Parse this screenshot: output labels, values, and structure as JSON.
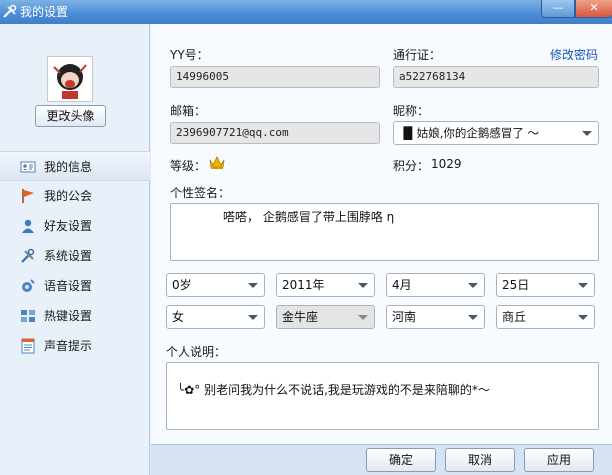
{
  "window": {
    "title": "我的设置",
    "minimize_label": "—",
    "close_label": "✕"
  },
  "sidebar": {
    "change_avatar": "更改头像",
    "items": [
      {
        "label": "我的信息",
        "icon": "id-card-icon"
      },
      {
        "label": "我的公会",
        "icon": "flag-icon"
      },
      {
        "label": "好友设置",
        "icon": "user-icon"
      },
      {
        "label": "系统设置",
        "icon": "tools-icon"
      },
      {
        "label": "语音设置",
        "icon": "speaker-icon"
      },
      {
        "label": "热键设置",
        "icon": "keyboard-icon"
      },
      {
        "label": "声音提示",
        "icon": "notice-icon"
      }
    ]
  },
  "form": {
    "yy_label": "YY号：",
    "yy_value": "14996005",
    "passport_label": "通行证：",
    "change_password": "修改密码",
    "passport_value": "a522768134",
    "email_label": "邮箱：",
    "email_value": "2396907721@qq.com",
    "nickname_label": "昵称：",
    "nickname_value": "▐▌姑娘,你的企鹅感冒了 ～",
    "level_label": "等级：",
    "points_label": "积分：",
    "points_value": "1029",
    "signature_label": "个性签名：",
    "signature_value": "嗒嗒，  企鹅感冒了带上围脖咯 η",
    "age": "0岁",
    "year": "2011年",
    "month": "4月",
    "day": "25日",
    "gender": "女",
    "zodiac": "金牛座",
    "province": "河南",
    "city": "商丘",
    "description_label": "个人说明：",
    "description_value": "╰✿° 别老问我为什么不说话,我是玩游戏的不是来陪聊的*～"
  },
  "footer": {
    "ok": "确定",
    "cancel": "取消",
    "apply": "应用"
  },
  "colors": {
    "title_bar": "#4d8dd6",
    "link": "#1857b8",
    "sidebar_bg": "#e8f0f9"
  }
}
